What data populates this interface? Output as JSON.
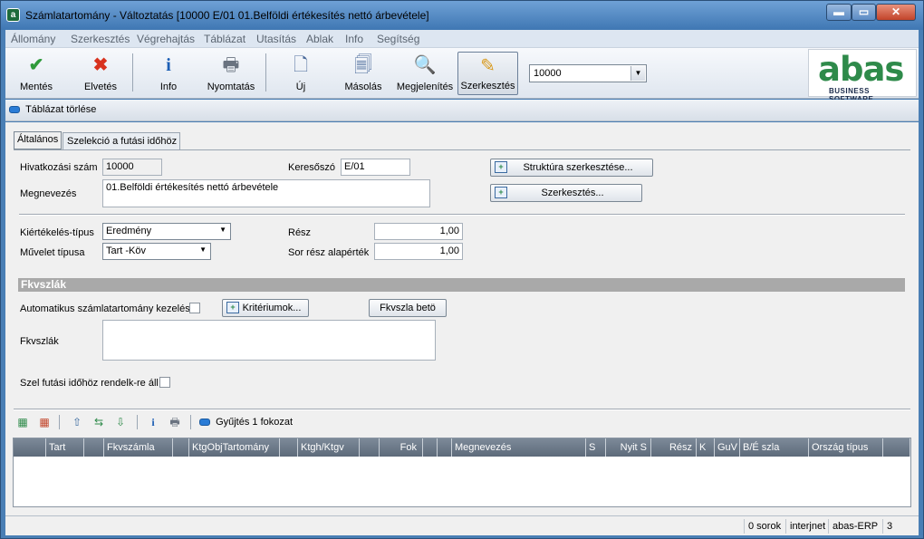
{
  "window": {
    "title": "Számlatartomány - Változtatás  [10000  E/01  01.Belföldi értékesítés nettó árbevétele]",
    "app_icon": "a",
    "min_label": "▬",
    "max_label": "▭",
    "close_label": "✕"
  },
  "menu": [
    "Állomány",
    "Szerkesztés",
    "Végrehajtás",
    "Táblázat",
    "Utasítás",
    "Ablak",
    "Info",
    "Segítség"
  ],
  "toolbar": {
    "save": "Mentés",
    "discard": "Elvetés",
    "info": "Info",
    "print": "Nyomtatás",
    "new": "Új",
    "copy": "Másolás",
    "view": "Megjelenítés",
    "edit": "Szerkesztés",
    "combo_value": "10000"
  },
  "logo": {
    "brand": "abas",
    "tagline": "BUSINESS SOFTWARE"
  },
  "subbar": {
    "clear_table": "Táblázat törlése"
  },
  "tabs": [
    "Általános",
    "Szelekció a futási időhöz"
  ],
  "form": {
    "ref_label": "Hivatkozási szám",
    "ref_value": "10000",
    "keyword_label": "Keresőszó",
    "keyword_value": "E/01",
    "name_label": "Megnevezés",
    "name_value": "01.Belföldi értékesítés nettó árbevétele",
    "structure_button": "Struktúra szerkesztése...",
    "edit_button": "Szerkesztés...",
    "eval_type_label": "Kiértékelés-típus",
    "eval_type_value": "Eredmény",
    "op_type_label": "Művelet típusa",
    "op_type_value": "Tart -Köv",
    "part_label": "Rész",
    "part_value": "1,00",
    "row_part_label": "Sor rész alapérték",
    "row_part_value": "1,00",
    "section_title": "Fkvszlák",
    "auto_label": "Automatikus számlatartomány kezelés",
    "criteria_button": "Kritériumok...",
    "entry_button": "Fkvszla betö",
    "accounts_label": "Fkvszlák",
    "runtime_label": "Szel futási időhöz rendelk-re áll"
  },
  "gridbar": {
    "collect": "Gyűjtés 1 fokozat"
  },
  "grid_columns": [
    "",
    "Tart",
    "",
    "Fkvszámla",
    "",
    "KtgObjTartomány",
    "",
    "Ktgh/Ktgv",
    "",
    "Fok",
    "",
    "",
    "Megnevezés",
    "S",
    "Nyit S",
    "Rész",
    "K",
    "GuV",
    "B/É szla",
    "Ország típus",
    ""
  ],
  "status": {
    "rows": "0 sorok",
    "net": "interjnet",
    "erp": "abas-ERP",
    "num": "3"
  }
}
